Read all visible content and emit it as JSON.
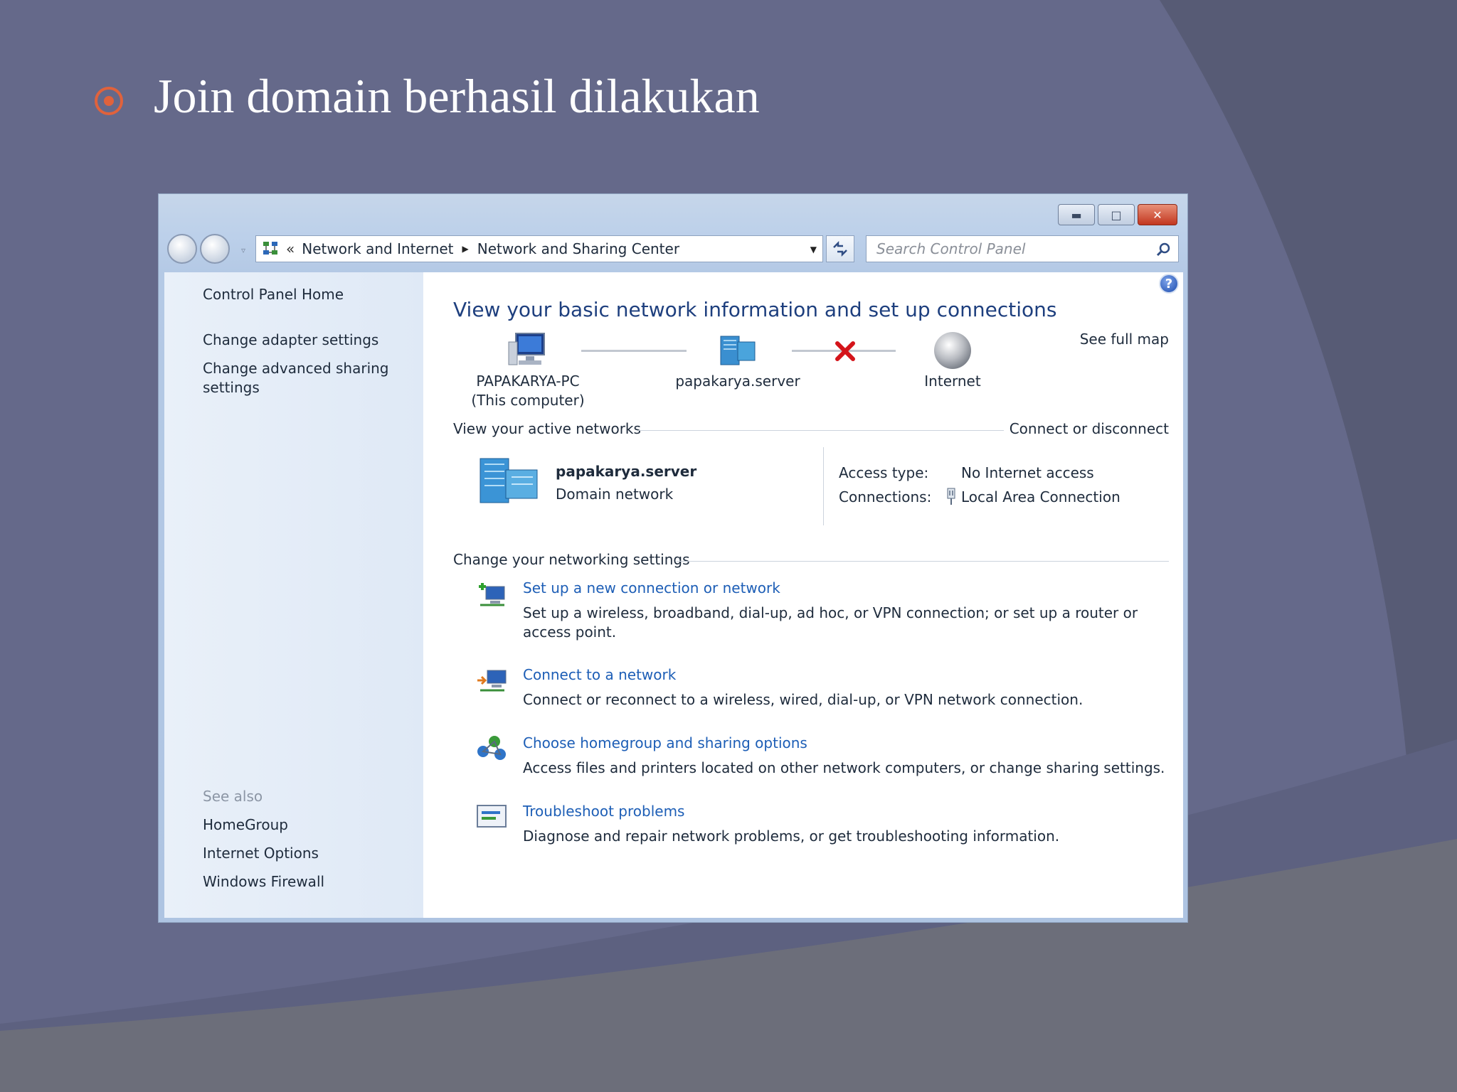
{
  "slide": {
    "title": "Join domain berhasil dilakukan"
  },
  "window": {
    "breadcrumb": {
      "chevrons": "«",
      "part1": "Network and Internet",
      "part2": "Network and Sharing Center"
    },
    "search_placeholder": "Search Control Panel"
  },
  "sidebar": {
    "home": "Control Panel Home",
    "links": [
      "Change adapter settings",
      "Change advanced sharing settings"
    ],
    "see_also_label": "See also",
    "see_also": [
      "HomeGroup",
      "Internet Options",
      "Windows Firewall"
    ]
  },
  "main": {
    "heading": "View your basic network information and set up connections",
    "see_full_map": "See full map",
    "map": {
      "computer_name": "PAPAKARYA-PC",
      "computer_sub": "(This computer)",
      "server": "papakarya.server",
      "internet": "Internet"
    },
    "active_networks": {
      "label": "View your active networks",
      "connect_link": "Connect or disconnect",
      "network_name": "papakarya.server",
      "network_type": "Domain network",
      "access_type_label": "Access type:",
      "access_type_value": "No Internet access",
      "connections_label": "Connections:",
      "connections_value": "Local Area Connection"
    },
    "settings": {
      "label": "Change your networking settings",
      "tasks": [
        {
          "title": "Set up a new connection or network",
          "desc": "Set up a wireless, broadband, dial-up, ad hoc, or VPN connection; or set up a router or access point."
        },
        {
          "title": "Connect to a network",
          "desc": "Connect or reconnect to a wireless, wired, dial-up, or VPN network connection."
        },
        {
          "title": "Choose homegroup and sharing options",
          "desc": "Access files and printers located on other network computers, or change sharing settings."
        },
        {
          "title": "Troubleshoot problems",
          "desc": "Diagnose and repair network problems, or get troubleshooting information."
        }
      ]
    }
  },
  "colors": {
    "accent_bullet": "#e0623c",
    "link": "#1d5eb6",
    "heading": "#1e3f7e",
    "slide_bg": "#65698a"
  }
}
